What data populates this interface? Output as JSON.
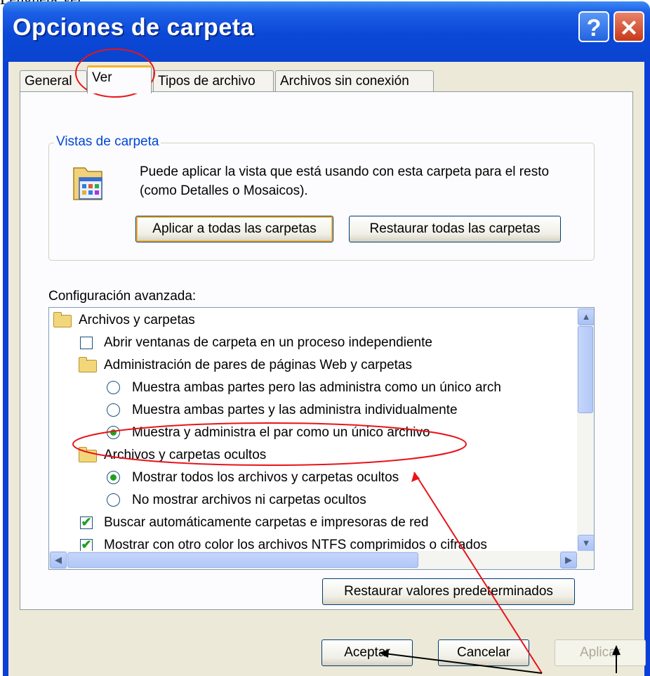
{
  "page": {
    "doc_text": "Lengüeta Ver:"
  },
  "window": {
    "title": "Opciones de carpeta",
    "help_label": "?",
    "close_label": "✕"
  },
  "tabs": [
    {
      "label": "General"
    },
    {
      "label": "Ver",
      "active": true
    },
    {
      "label": "Tipos de archivo"
    },
    {
      "label": "Archivos sin conexión"
    }
  ],
  "vistas": {
    "title": "Vistas de carpeta",
    "description": "Puede aplicar la vista que está usando con esta carpeta para el resto (como Detalles o Mosaicos).",
    "apply_all": "Aplicar a todas las carpetas",
    "restore_all": "Restaurar todas las carpetas"
  },
  "advanced": {
    "label": "Configuración avanzada:",
    "items": [
      {
        "type": "folder",
        "label": "Archivos y carpetas"
      },
      {
        "type": "checkbox",
        "checked": false,
        "label": "Abrir ventanas de carpeta  en un proceso independiente"
      },
      {
        "type": "folder",
        "label": "Administración de pares de páginas Web y carpetas"
      },
      {
        "type": "radio",
        "checked": false,
        "label": "Muestra ambas partes pero las administra como un único arch"
      },
      {
        "type": "radio",
        "checked": false,
        "label": "Muestra ambas partes y las administra individualmente"
      },
      {
        "type": "radio",
        "checked": true,
        "label": "Muestra y administra el par como un único archivo"
      },
      {
        "type": "folder",
        "label": "Archivos y carpetas ocultos"
      },
      {
        "type": "radio",
        "checked": true,
        "label": "Mostrar todos los archivos y carpetas ocultos"
      },
      {
        "type": "radio",
        "checked": false,
        "label": "No mostrar archivos ni carpetas ocultos"
      },
      {
        "type": "checkbox",
        "checked": true,
        "label": "Buscar automáticamente carpetas e impresoras de red"
      },
      {
        "type": "checkbox",
        "checked": true,
        "label": "Mostrar con otro color los archivos NTFS comprimidos o cifrados"
      }
    ],
    "restore_defaults": "Restaurar valores predeterminados"
  },
  "footer": {
    "ok": "Aceptar",
    "cancel": "Cancelar",
    "apply": "Aplicar"
  },
  "colors": {
    "annotation_red": "#e8141a",
    "titlebar": "#0b48d6",
    "dialog": "#ece9d8"
  }
}
